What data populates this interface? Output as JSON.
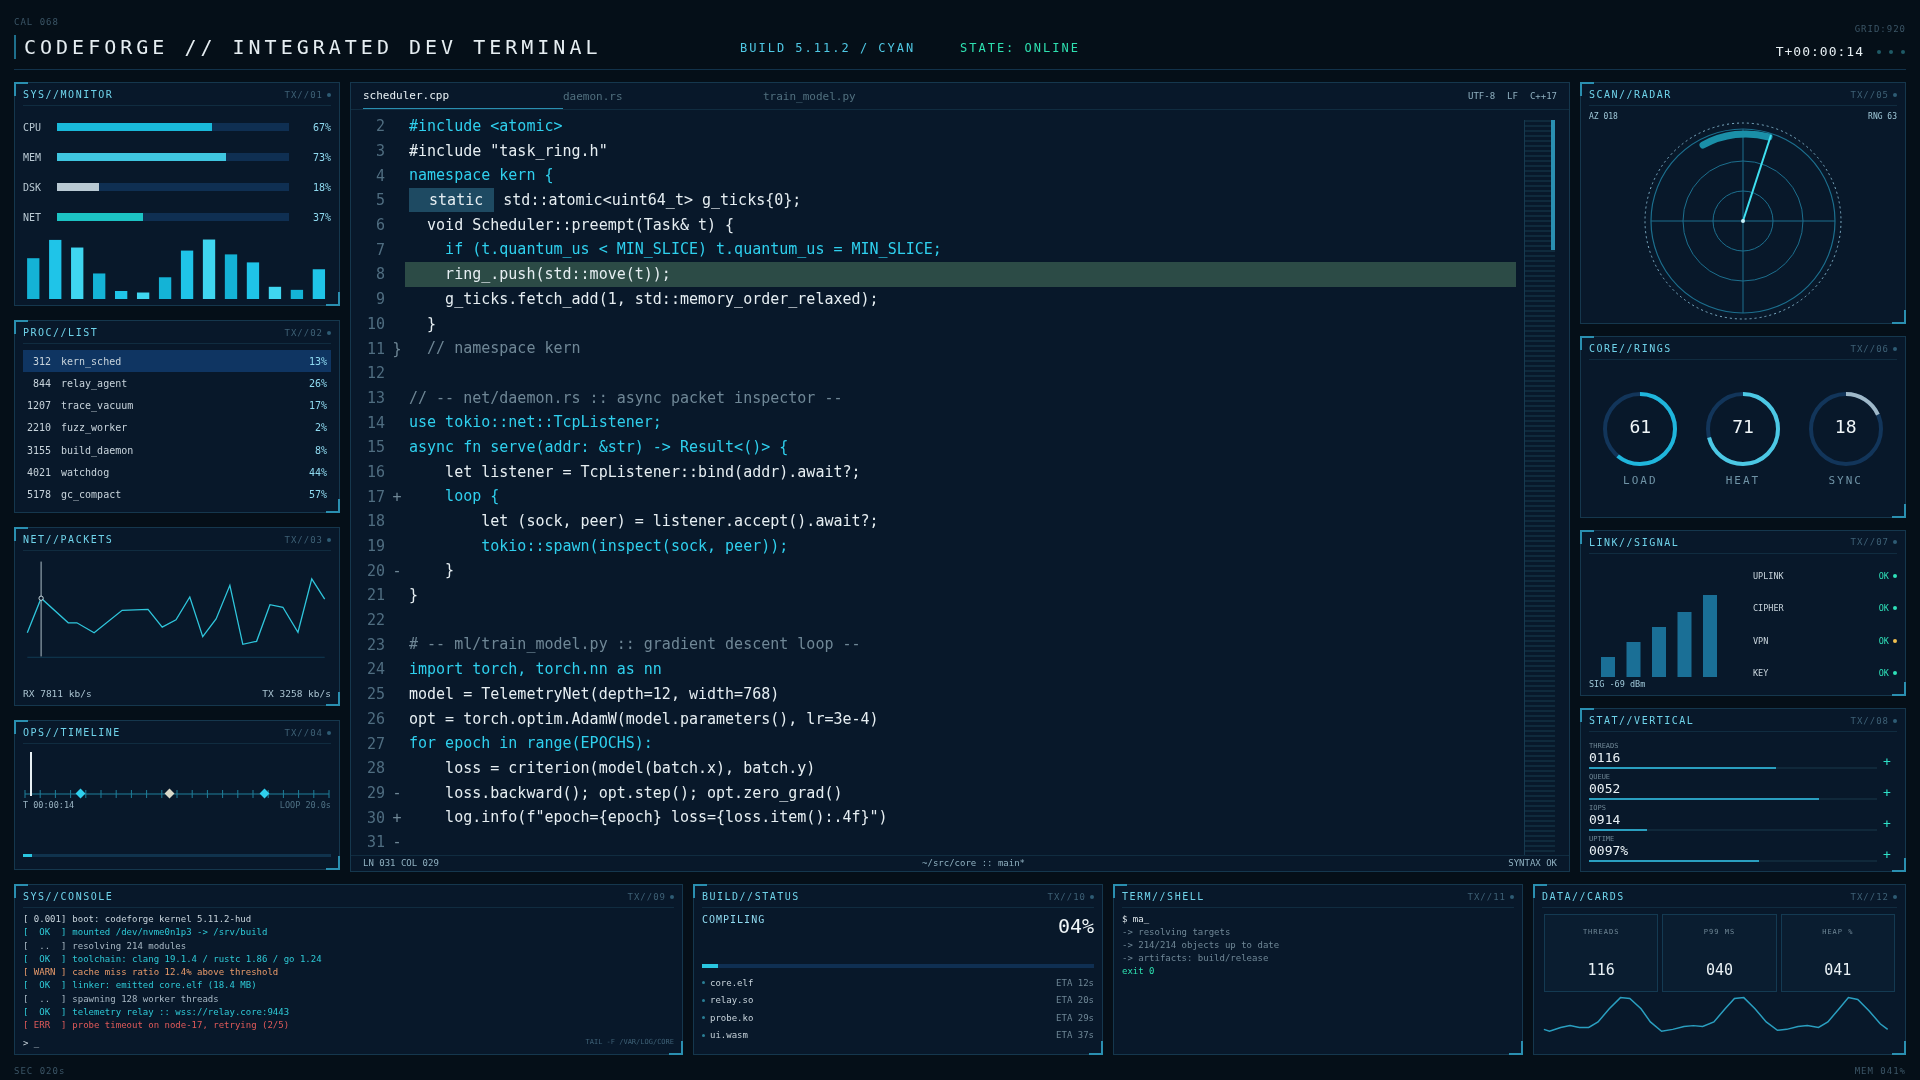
{
  "header": {
    "corner_code": "CAL 068",
    "title": "CODEFORGE // INTEGRATED DEV TERMINAL",
    "build": "BUILD 5.11.2 / CYAN",
    "state": "STATE: ONLINE",
    "timer": "T+00:00:14",
    "grid_code": "GRID:920"
  },
  "monitor": {
    "title": "SYS//MONITOR",
    "code": "TX//01",
    "metrics": [
      {
        "label": "CPU",
        "level": 0.67,
        "value": "67%",
        "color": "#19b9da"
      },
      {
        "label": "MEM",
        "level": 0.73,
        "value": "73%",
        "color": "#3fc6e0"
      },
      {
        "label": "DSK",
        "level": 0.18,
        "value": "18%",
        "color": "#b9c9d3"
      },
      {
        "label": "NET",
        "level": 0.37,
        "value": "37%",
        "color": "#1cc3c4"
      }
    ]
  },
  "processes": {
    "title": "PROC//LIST",
    "code": "TX//02",
    "rows": [
      {
        "pid": "312",
        "name": "kern_sched",
        "pct": "13%",
        "selected": true
      },
      {
        "pid": "844",
        "name": "relay_agent",
        "pct": "26%",
        "selected": false
      },
      {
        "pid": "1207",
        "name": "trace_vacuum",
        "pct": "17%",
        "selected": false
      },
      {
        "pid": "2210",
        "name": "fuzz_worker",
        "pct": "2%",
        "selected": false
      },
      {
        "pid": "3155",
        "name": "build_daemon",
        "pct": "8%",
        "selected": false
      },
      {
        "pid": "4021",
        "name": "watchdog",
        "pct": "44%",
        "selected": false
      },
      {
        "pid": "5178",
        "name": "gc_compact",
        "pct": "57%",
        "selected": false
      }
    ]
  },
  "packets": {
    "title": "NET//PACKETS",
    "code": "TX//03",
    "rx": "RX 7811 kb/s",
    "tx": "TX 3258 kb/s"
  },
  "timeline": {
    "title": "OPS//TIMELINE",
    "code": "TX//04",
    "time": "T 00:00:14",
    "loop": "LOOP 20.0s",
    "progress": {
      "level": 0.03
    }
  },
  "editor": {
    "tabs": [
      {
        "label": "scheduler.cpp",
        "selected": true
      },
      {
        "label": "daemon.rs",
        "selected": false
      },
      {
        "label": "train_model.py",
        "selected": false
      }
    ],
    "encoding": "UTF-8",
    "line_ending": "LF",
    "language": "C++17",
    "lines": [
      {
        "num": "2",
        "kind": "keyword",
        "text": "#include <atomic>",
        "selected": false
      },
      {
        "num": "3",
        "kind": "code",
        "text": "#include \"task_ring.h\"",
        "selected": false
      },
      {
        "num": "4",
        "kind": "keyword",
        "text": "namespace kern {",
        "selected": false
      },
      {
        "num": "5",
        "kind": "code",
        "selection": "static",
        "text": "std::atomic<uint64_t> g_ticks{0};",
        "selected": false
      },
      {
        "num": "6",
        "kind": "code",
        "text": "  void Scheduler::preempt(Task& t) {",
        "selected": false
      },
      {
        "num": "7",
        "kind": "keyword",
        "text": "    if (t.quantum_us < MIN_SLICE) t.quantum_us = MIN_SLICE;",
        "selected": false
      },
      {
        "num": "8",
        "kind": "code",
        "text": "    ring_.push(std::move(t));",
        "selected": true
      },
      {
        "num": "9",
        "kind": "code",
        "text": "    g_ticks.fetch_add(1, std::memory_order_relaxed);",
        "selected": false
      },
      {
        "num": "10",
        "kind": "code",
        "text": "  }",
        "selected": false
      },
      {
        "num": "11",
        "kind": "comment",
        "marker": "}",
        "text": "  // namespace kern",
        "selected": false
      },
      {
        "num": "12",
        "kind": "code",
        "selected": false
      },
      {
        "num": "13",
        "kind": "comment",
        "text": "// -- net/daemon.rs :: async packet inspector --",
        "selected": false
      },
      {
        "num": "14",
        "kind": "keyword",
        "text": "use tokio::net::TcpListener;",
        "selected": false
      },
      {
        "num": "15",
        "kind": "keyword",
        "text": "async fn serve(addr: &str) -> Result<()> {",
        "selected": false
      },
      {
        "num": "16",
        "kind": "code",
        "text": "    let listener = TcpListener::bind(addr).await?;",
        "selected": false
      },
      {
        "num": "17",
        "kind": "keyword",
        "marker": "+",
        "text": "    loop {",
        "selected": false
      },
      {
        "num": "18",
        "kind": "code",
        "text": "        let (sock, peer) = listener.accept().await?;",
        "selected": false
      },
      {
        "num": "19",
        "kind": "keyword",
        "text": "        tokio::spawn(inspect(sock, peer));",
        "selected": false
      },
      {
        "num": "20",
        "kind": "code",
        "marker": "-",
        "text": "    }",
        "selected": false
      },
      {
        "num": "21",
        "kind": "code",
        "text": "}",
        "selected": false
      },
      {
        "num": "22",
        "kind": "code",
        "selected": false
      },
      {
        "num": "23",
        "kind": "comment",
        "text": "# -- ml/train_model.py :: gradient descent loop --",
        "selected": false
      },
      {
        "num": "24",
        "kind": "keyword",
        "text": "import torch, torch.nn as nn",
        "selected": false
      },
      {
        "num": "25",
        "kind": "code",
        "text": "model = TelemetryNet(depth=12, width=768)",
        "selected": false
      },
      {
        "num": "26",
        "kind": "code",
        "text": "opt = torch.optim.AdamW(model.parameters(), lr=3e-4)",
        "selected": false
      },
      {
        "num": "27",
        "kind": "keyword",
        "text": "for epoch in range(EPOCHS):",
        "selected": false
      },
      {
        "num": "28",
        "kind": "code",
        "text": "    loss = criterion(model(batch.x), batch.y)",
        "selected": false
      },
      {
        "num": "29",
        "kind": "code",
        "marker": "-",
        "text": "    loss.backward(); opt.step(); opt.zero_grad()",
        "selected": false
      },
      {
        "num": "30",
        "kind": "code",
        "marker": "+",
        "text": "    log.info(f\"epoch={epoch} loss={loss.item():.4f}\")",
        "selected": false
      },
      {
        "num": "31",
        "kind": "code",
        "marker": "-",
        "selected": false
      }
    ],
    "cursor": "LN 031  COL 029",
    "path": "~/src/core :: main*",
    "syntax": "SYNTAX OK"
  },
  "radar": {
    "title": "SCAN//RADAR",
    "code": "TX//05",
    "azimuth": "AZ 018",
    "range": "RNG 63"
  },
  "rings": {
    "title": "CORE//RINGS",
    "code": "TX//06",
    "items": [
      {
        "value": "61",
        "label": "LOAD",
        "color": "#1fb6dc"
      },
      {
        "value": "71",
        "label": "HEAT",
        "color": "#4cc8e4"
      },
      {
        "value": "18",
        "label": "SYNC",
        "color": "#9fb8c8"
      }
    ]
  },
  "signal": {
    "title": "LINK//SIGNAL",
    "code": "TX//07",
    "reading": "SIG -69 dBm",
    "links": [
      {
        "name": "UPLINK",
        "status": "OK",
        "color": "#2ee0b8"
      },
      {
        "name": "CIPHER",
        "status": "OK",
        "color": "#2ee0b8"
      },
      {
        "name": "VPN",
        "status": "OK",
        "color": "#f0c050"
      },
      {
        "name": "KEY",
        "status": "OK",
        "color": "#2ee0b8"
      }
    ]
  },
  "stats": {
    "title": "STAT//VERTICAL",
    "code": "TX//08",
    "rows": [
      {
        "label": "THREADS",
        "value": "0116",
        "level": 0.65,
        "action": "+"
      },
      {
        "label": "QUEUE",
        "value": "0052",
        "level": 0.8,
        "action": "+"
      },
      {
        "label": "IOPS",
        "value": "0914",
        "level": 0.2,
        "action": "+"
      },
      {
        "label": "UPTIME",
        "value": "0097%",
        "level": 0.59,
        "action": "+"
      }
    ]
  },
  "console": {
    "title": "SYS//CONSOLE",
    "code": "TX//09",
    "lines": [
      {
        "tag": "[ 0.001]",
        "text": "boot: codeforge kernel 5.11.2-hud",
        "kind": "info"
      },
      {
        "tag": "[  OK  ]",
        "text": "mounted /dev/nvme0n1p3 -> /srv/build",
        "kind": "ok"
      },
      {
        "tag": "[  ..  ]",
        "text": "resolving 214 modules",
        "kind": "pending"
      },
      {
        "tag": "[  OK  ]",
        "text": "toolchain: clang 19.1.4 / rustc 1.86 / go 1.24",
        "kind": "ok"
      },
      {
        "tag": "[ WARN ]",
        "text": "cache miss ratio 12.4% above threshold",
        "kind": "warn"
      },
      {
        "tag": "[  OK  ]",
        "text": "linker: emitted core.elf (18.4 MB)",
        "kind": "ok"
      },
      {
        "tag": "[  ..  ]",
        "text": "spawning 128 worker threads",
        "kind": "pending"
      },
      {
        "tag": "[  OK  ]",
        "text": "telemetry relay :: wss://relay.core:9443",
        "kind": "ok"
      },
      {
        "tag": "[ ERR  ]",
        "text": "probe timeout on node-17, retrying (2/5)",
        "kind": "err"
      }
    ],
    "prompt": "> _",
    "tail": "TAIL -F /VAR/LOG/CORE"
  },
  "build": {
    "title": "BUILD//STATUS",
    "code": "TX//10",
    "status": "COMPILING",
    "percent": "04%",
    "level": 0.04,
    "items": [
      {
        "name": "core.elf",
        "eta": "ETA 12s"
      },
      {
        "name": "relay.so",
        "eta": "ETA 20s"
      },
      {
        "name": "probe.ko",
        "eta": "ETA 29s"
      },
      {
        "name": "ui.wasm",
        "eta": "ETA 37s"
      }
    ]
  },
  "shell": {
    "title": "TERM//SHELL",
    "code": "TX//11",
    "lines": [
      {
        "text": "$ ma_",
        "kind": "command"
      },
      {
        "text": "-> resolving targets",
        "kind": "output"
      },
      {
        "text": "-> 214/214 objects up to date",
        "kind": "output"
      },
      {
        "text": "-> artifacts: build/release",
        "kind": "output"
      },
      {
        "text": "exit 0",
        "kind": "exit"
      }
    ]
  },
  "cards": {
    "title": "DATA//CARDS",
    "code": "TX//12",
    "items": [
      {
        "label": "THREADS",
        "value": "116"
      },
      {
        "label": "P99 MS",
        "value": "040"
      },
      {
        "label": "HEAP %",
        "value": "041"
      }
    ]
  },
  "footer": {
    "left": "SEC 020s",
    "right": "MEM 041%"
  }
}
